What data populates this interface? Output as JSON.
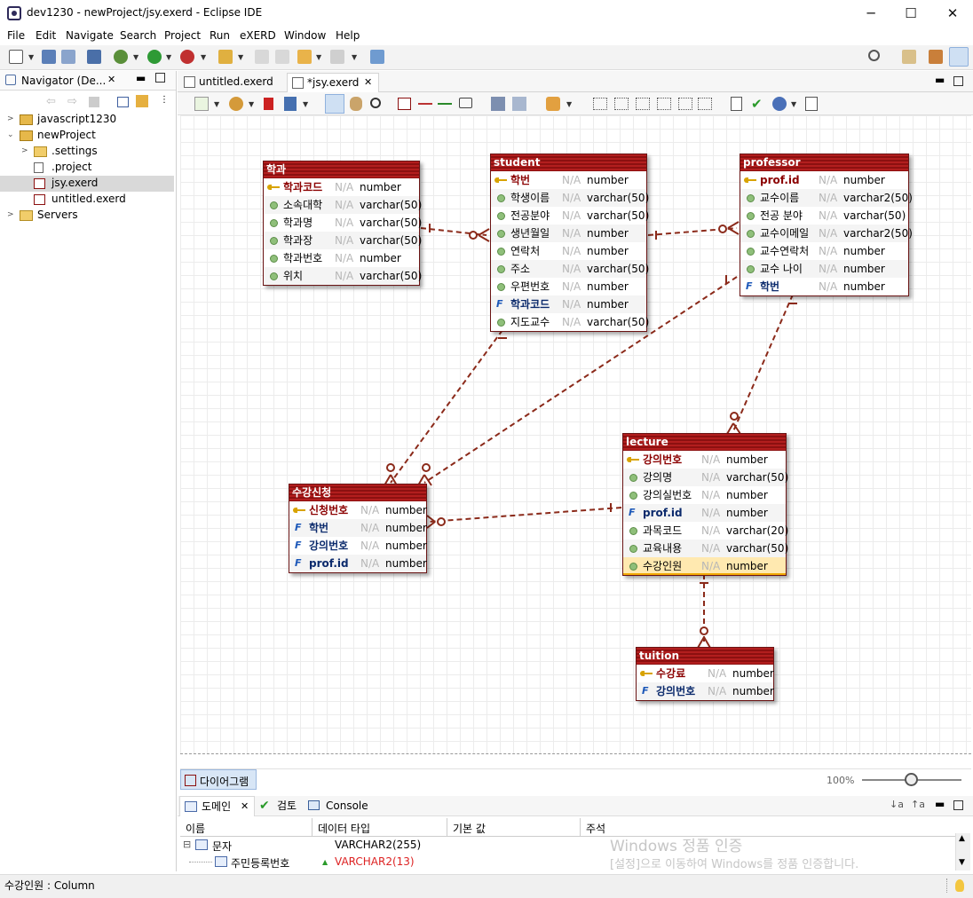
{
  "window": {
    "title": "dev1230 - newProject/jsy.exerd - Eclipse IDE",
    "minimize": "─",
    "maximize": "☐",
    "close": "✕"
  },
  "menu": [
    "File",
    "Edit",
    "Navigate",
    "Search",
    "Project",
    "Run",
    "eXERD",
    "Window",
    "Help"
  ],
  "navigator": {
    "tab": "Navigator (De...",
    "tree": [
      {
        "label": "javascript1230",
        "twisty": ">",
        "icon": "project-icon"
      },
      {
        "label": "newProject",
        "twisty": "⌄",
        "icon": "project-icon"
      },
      {
        "label": ".settings",
        "twisty": ">",
        "icon": "folder-icon"
      },
      {
        "label": ".project",
        "twisty": "",
        "icon": "xml-file-icon"
      },
      {
        "label": "jsy.exerd",
        "twisty": "",
        "icon": "exerd-file-icon",
        "selected": true
      },
      {
        "label": "untitled.exerd",
        "twisty": "",
        "icon": "exerd-file-icon"
      },
      {
        "label": "Servers",
        "twisty": ">",
        "icon": "folder-icon"
      }
    ]
  },
  "editor": {
    "tabs": [
      {
        "label": "untitled.exerd",
        "active": false
      },
      {
        "label": "*jsy.exerd",
        "active": true,
        "close": "✕"
      }
    ]
  },
  "entities": [
    {
      "name": "학과",
      "cols": [
        {
          "n": "학과코드",
          "k": "pk",
          "na": "N/A",
          "t": "number"
        },
        {
          "n": "소속대학",
          "k": "attr",
          "na": "N/A",
          "t": "varchar(50)"
        },
        {
          "n": "학과명",
          "k": "attr",
          "na": "N/A",
          "t": "varchar(50)"
        },
        {
          "n": "학과장",
          "k": "attr",
          "na": "N/A",
          "t": "varchar(50)"
        },
        {
          "n": "학과번호",
          "k": "attr",
          "na": "N/A",
          "t": "number"
        },
        {
          "n": "위치",
          "k": "attr",
          "na": "N/A",
          "t": "varchar(50)"
        }
      ]
    },
    {
      "name": "student",
      "cols": [
        {
          "n": "학번",
          "k": "pk",
          "na": "N/A",
          "t": "number"
        },
        {
          "n": "학생이름",
          "k": "attr",
          "na": "N/A",
          "t": "varchar(50)"
        },
        {
          "n": "전공분야",
          "k": "attr",
          "na": "N/A",
          "t": "varchar(50)"
        },
        {
          "n": "생년월일",
          "k": "attr",
          "na": "N/A",
          "t": "number"
        },
        {
          "n": "연락처",
          "k": "attr",
          "na": "N/A",
          "t": "number"
        },
        {
          "n": "주소",
          "k": "attr",
          "na": "N/A",
          "t": "varchar(50)"
        },
        {
          "n": "우편번호",
          "k": "attr",
          "na": "N/A",
          "t": "number"
        },
        {
          "n": "학과코드",
          "k": "fk",
          "na": "N/A",
          "t": "number"
        },
        {
          "n": "지도교수",
          "k": "attr",
          "na": "N/A",
          "t": "varchar(50)"
        }
      ]
    },
    {
      "name": "professor",
      "cols": [
        {
          "n": "prof.id",
          "k": "pk",
          "na": "N/A",
          "t": "number"
        },
        {
          "n": "교수이름",
          "k": "attr",
          "na": "N/A",
          "t": "varchar2(50)"
        },
        {
          "n": "전공 분야",
          "k": "attr",
          "na": "N/A",
          "t": "varchar(50)"
        },
        {
          "n": "교수이메일",
          "k": "attr",
          "na": "N/A",
          "t": "varchar2(50)"
        },
        {
          "n": "교수연락처",
          "k": "attr",
          "na": "N/A",
          "t": "number"
        },
        {
          "n": "교수 나이",
          "k": "attr",
          "na": "N/A",
          "t": "number"
        },
        {
          "n": "학번",
          "k": "fk",
          "na": "N/A",
          "t": "number"
        }
      ]
    },
    {
      "name": "lecture",
      "cols": [
        {
          "n": "강의번호",
          "k": "pk",
          "na": "N/A",
          "t": "number"
        },
        {
          "n": "강의명",
          "k": "attr",
          "na": "N/A",
          "t": "varchar(50)"
        },
        {
          "n": "강의실번호",
          "k": "attr",
          "na": "N/A",
          "t": "number"
        },
        {
          "n": "prof.id",
          "k": "fk",
          "na": "N/A",
          "t": "number"
        },
        {
          "n": "과목코드",
          "k": "attr",
          "na": "N/A",
          "t": "varchar(20)"
        },
        {
          "n": "교육내용",
          "k": "attr",
          "na": "N/A",
          "t": "varchar(50)"
        },
        {
          "n": "수강인원",
          "k": "attr",
          "na": "N/A",
          "t": "number",
          "hl": true
        }
      ]
    },
    {
      "name": "수강신청",
      "cols": [
        {
          "n": "신청번호",
          "k": "pk",
          "na": "N/A",
          "t": "number"
        },
        {
          "n": "학번",
          "k": "fk",
          "na": "N/A",
          "t": "number"
        },
        {
          "n": "강의번호",
          "k": "fk",
          "na": "N/A",
          "t": "number"
        },
        {
          "n": "prof.id",
          "k": "fk",
          "na": "N/A",
          "t": "number"
        }
      ]
    },
    {
      "name": "tuition",
      "cols": [
        {
          "n": "수강료",
          "k": "pk",
          "na": "N/A",
          "t": "number"
        },
        {
          "n": "강의번호",
          "k": "fk",
          "na": "N/A",
          "t": "number"
        }
      ]
    }
  ],
  "fk_mark": "F",
  "diagram_tab": "다이어그램",
  "zoom": "100%",
  "bottom": {
    "tabs": [
      "도메인",
      "검토",
      "Console"
    ],
    "close": "✕",
    "headers": [
      "이름",
      "데이터 타입",
      "기본 값",
      "주석"
    ],
    "rows": [
      {
        "expander": "⊟",
        "name": "문자",
        "type": "VARCHAR2(255)"
      },
      {
        "name": "주민등록번호",
        "type": "VARCHAR2(13)"
      }
    ]
  },
  "watermark": {
    "line1": "Windows 정품 인증",
    "line2": "[설정]으로 이동하여 Windows를 정품 인증합니다."
  },
  "status": "수강인원 : Column"
}
